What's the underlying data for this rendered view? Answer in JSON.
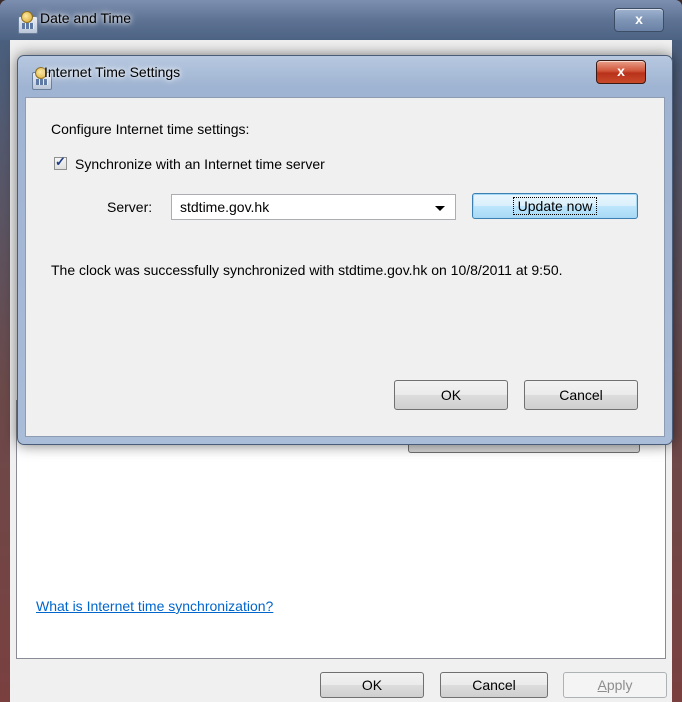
{
  "outer_window": {
    "title": "Date and Time",
    "close_label": "x",
    "link_text": "What is Internet time synchronization?",
    "ok_label": "OK",
    "cancel_label": "Cancel",
    "apply_label": "Apply"
  },
  "dialog": {
    "title": "Internet Time Settings",
    "close_label": "x",
    "heading": "Configure Internet time settings:",
    "sync_checkbox": {
      "label": "Synchronize with an Internet time server",
      "checked": true
    },
    "server_label": "Server:",
    "server_value": "stdtime.gov.hk",
    "update_label": "Update now",
    "status": "The clock was successfully synchronized with stdtime.gov.hk on 10/8/2011 at 9:50.",
    "ok_label": "OK",
    "cancel_label": "Cancel"
  },
  "colors": {
    "link": "#0066cc",
    "close_button": "#c94a2b",
    "default_button_border": "#3c7fb1"
  }
}
